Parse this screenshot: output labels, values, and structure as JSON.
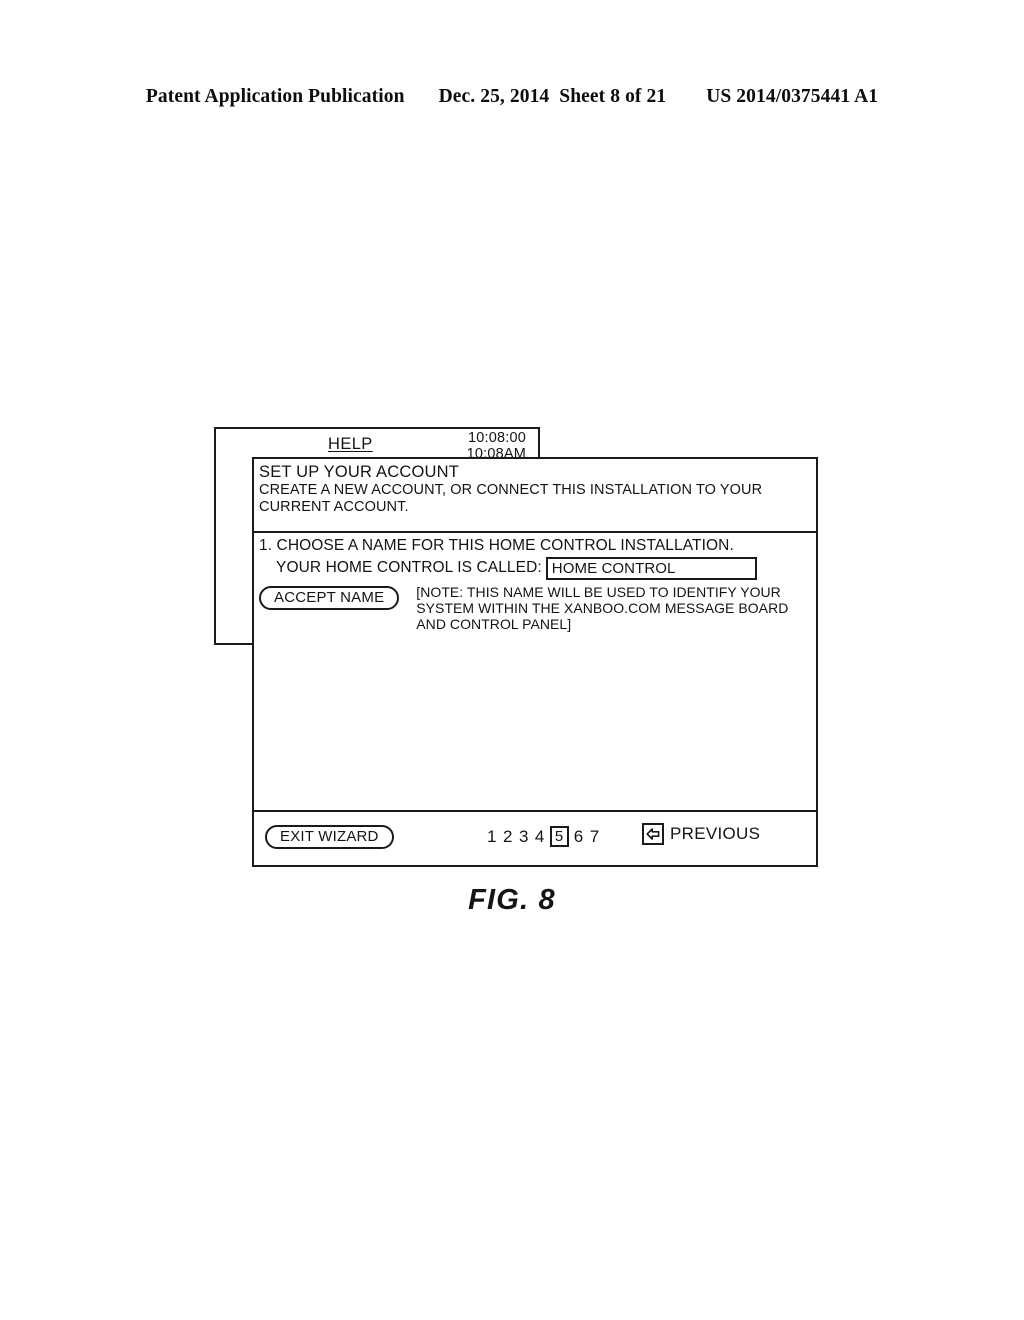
{
  "page_header": {
    "publication": "Patent Application Publication",
    "date": "Dec. 25, 2014",
    "sheet": "Sheet 8 of 21",
    "document_number": "US 2014/0375441 A1"
  },
  "figure": {
    "caption": "FIG. 8"
  },
  "help_window": {
    "title": "HELP",
    "clock_time": "10:08:00",
    "clock_ampm": "10:08AM"
  },
  "wizard": {
    "heading": "SET UP YOUR ACCOUNT",
    "subtext": "CREATE A NEW ACCOUNT, OR CONNECT THIS INSTALLATION TO YOUR CURRENT ACCOUNT.",
    "step_line_1": "1. CHOOSE A NAME FOR THIS HOME CONTROL INSTALLATION.",
    "step_line_2_label": "YOUR HOME CONTROL IS CALLED:",
    "name_field_value": "HOME CONTROL",
    "name_field_placeholder": "HOME CONTROL",
    "accept_button": "ACCEPT NAME",
    "note": "[NOTE: THIS NAME WILL BE USED TO IDENTIFY YOUR SYSTEM WITHIN THE XANBOO.COM MESSAGE BOARD AND CONTROL PANEL]",
    "footer": {
      "exit_button": "EXIT WIZARD",
      "pages": [
        "1",
        "2",
        "3",
        "4",
        "5",
        "6",
        "7"
      ],
      "current_page": "5",
      "previous_label": "PREVIOUS",
      "previous_icon": "left-arrow-icon"
    }
  },
  "colors": {
    "page_background": "#ffffff",
    "ink": "#141414",
    "border": "#1a1a1a"
  }
}
